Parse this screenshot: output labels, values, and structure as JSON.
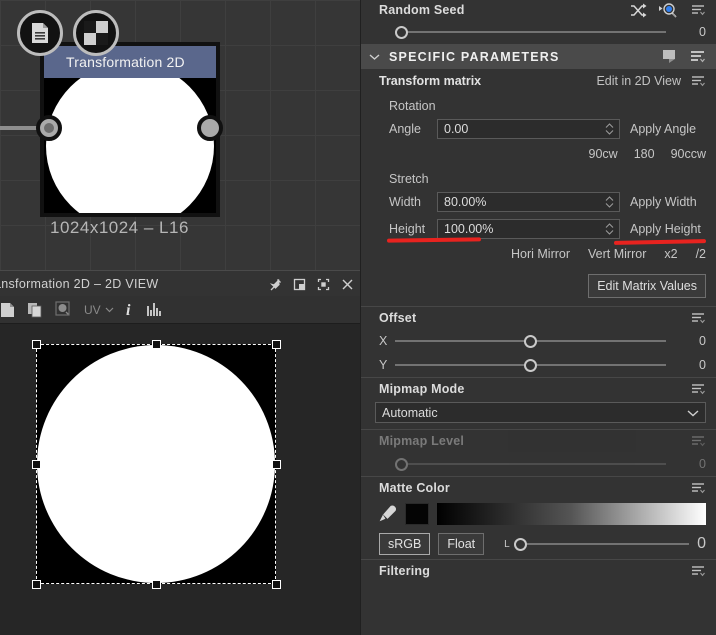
{
  "node_graph": {
    "node_title": "Transformation 2D",
    "resolution_label": "1024x1024 – L16",
    "badges": [
      "document-icon",
      "checkerboard-icon"
    ]
  },
  "view2d": {
    "title": "ansformation 2D – 2D VIEW",
    "window_buttons": [
      "pin-icon",
      "maximize-icon",
      "fit-icon",
      "close-icon"
    ],
    "toolbar": {
      "uv_label": "UV",
      "items": [
        "save-image-icon",
        "copy-icon",
        "render-icon",
        "uv-selector",
        "info-icon",
        "histogram-icon"
      ]
    }
  },
  "panel": {
    "random_seed": {
      "label": "Random Seed",
      "value": "0",
      "icons": [
        "shuffle-icon",
        "pick-target-icon",
        "menu-icon"
      ]
    },
    "specific_parameters": {
      "label": "SPECIFIC PARAMETERS",
      "chevron": "chevron-down-icon",
      "icons": [
        "bookmark-icon",
        "menu-icon"
      ]
    },
    "transform_matrix": {
      "label": "Transform matrix",
      "edit_link": "Edit in 2D View",
      "rotation": {
        "group_label": "Rotation",
        "angle_label": "Angle",
        "angle_value": "0.00",
        "apply_label": "Apply Angle",
        "quick_buttons": [
          "90cw",
          "180",
          "90ccw"
        ]
      },
      "stretch": {
        "group_label": "Stretch",
        "width_label": "Width",
        "width_value": "80.00%",
        "apply_width_label": "Apply Width",
        "height_label": "Height",
        "height_value": "100.00%",
        "apply_height_label": "Apply Height",
        "quick_buttons": [
          "Hori Mirror",
          "Vert Mirror",
          "x2",
          "/2"
        ]
      },
      "edit_matrix_button": "Edit Matrix Values"
    },
    "offset": {
      "label": "Offset",
      "x_label": "X",
      "x_value": "0",
      "y_label": "Y",
      "y_value": "0"
    },
    "mipmap_mode": {
      "label": "Mipmap Mode",
      "selected": "Automatic"
    },
    "mipmap_level": {
      "label": "Mipmap Level",
      "value": "0",
      "disabled": true
    },
    "matte_color": {
      "label": "Matte Color",
      "eyedropper": "eyedropper-icon",
      "swatch_color": "#040404",
      "srgb_label": "sRGB",
      "float_label": "Float",
      "l_label": "L",
      "l_value": "0"
    },
    "filtering": {
      "label": "Filtering"
    }
  },
  "annotations": {
    "color": "#e8231f",
    "marks": [
      "underline-width-field",
      "underline-apply-width"
    ]
  }
}
